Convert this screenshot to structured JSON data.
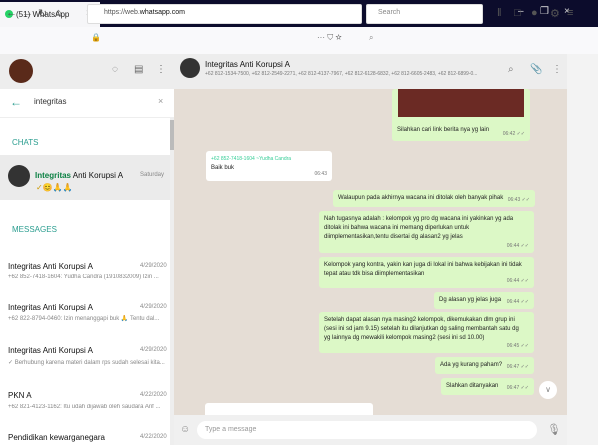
{
  "browser": {
    "tab_title": "(51) WhatsApp",
    "tab_close": "×",
    "new_tab": "+",
    "win_min": "–",
    "win_max": "❐",
    "win_close": "×",
    "url_prefix": "https://web.",
    "url_domain": "whatsapp.com",
    "url_menu": "··· ⛉ ☆",
    "search_placeholder": "Search"
  },
  "sidebar": {
    "search_value": "integritas",
    "chats_label": "CHATS",
    "messages_label": "MESSAGES",
    "chat": {
      "name_highlight": "Integritas",
      "name_rest": " Anti Korupsi A",
      "time": "Saturday",
      "preview": "✓😊🙏🙏"
    },
    "messages": [
      {
        "name": "Integritas Anti Korupsi A",
        "date": "4/29/2020",
        "preview": "+62 852-7418-1604: Yudha Candra (1910832009) Izin ..."
      },
      {
        "name": "Integritas Anti Korupsi A",
        "date": "4/29/2020",
        "preview": "+62 822-8794-0460: Izin menanggapi buk 🙏 Tentu dal..."
      },
      {
        "name": "Integritas Anti Korupsi A",
        "date": "4/29/2020",
        "preview": "✓ Berhubung karena materi dalam rps sudah selesai kita..."
      },
      {
        "name": "PKN A",
        "date": "4/22/2020",
        "preview": "+62 821-4123-1162: Itu udah dijawab oleh saudara Arif ..."
      },
      {
        "name": "Pendidikan kewarganegara",
        "date": "4/22/2020",
        "preview": ""
      }
    ]
  },
  "conversation": {
    "title": "Integritas Anti Korupsi A",
    "participants": "+62 812-1534-7500, +62 812-2549-2271, +62 812-4137-7967, +62 812-6128-6832, +62 812-6605-2483, +62 812-6899-0...",
    "messages": [
      {
        "dir": "out",
        "text": "Silahkan cari link berita nya yg lain",
        "time": "06:42 ✓✓"
      },
      {
        "dir": "in",
        "sender": "+62 852-7418-1604 ~Yudha Candra",
        "text": "Baik buk",
        "time": "06:43"
      },
      {
        "dir": "out",
        "text": "Walaupun pada akhirnya wacana ini ditolak oleh banyak pihak",
        "time": "06:43 ✓✓"
      },
      {
        "dir": "out",
        "text": "Nah tugasnya adalah : kelompok yg pro dg wacana ini yakinkan yg ada ditolak ini bahwa wacana ini memang diperlukan untuk diimplementasikan,tentu disertai dg alasan2 yg jelas",
        "time": "06:44 ✓✓"
      },
      {
        "dir": "out",
        "text": "Kelompok yang kontra, yakin kan juga di lokal ini bahwa kebijakan ini tidak tepat atau tdk bisa diimplementasikan",
        "time": "06:44 ✓✓"
      },
      {
        "dir": "out",
        "text": "Dg alasan yg jelas juga",
        "time": "06:44 ✓✓"
      },
      {
        "dir": "out",
        "text": "Setelah dapat alasan nya masing2 kelompok, dikemukakan dlm grup ini (sesi ini sd jam 9.15) setelah itu dilanjutkan dg saling membantah satu dg yg lainnya dg mewakili kelompok masing2 (sesi ini sd 10.00)",
        "time": "06:45 ✓✓"
      },
      {
        "dir": "out",
        "text": "Ada yg kurang paham?",
        "time": "06:47 ✓✓"
      },
      {
        "dir": "out",
        "text": "Slahkan ditanyakan",
        "time": "06:47 ✓✓"
      }
    ],
    "composer_placeholder": "Type a message"
  },
  "icons": [
    "back-icon",
    "forward-icon",
    "reload-icon",
    "home-icon",
    "shield-icon",
    "lock-icon",
    "search-icon",
    "library-icon",
    "reader-icon",
    "profile-icon",
    "menu-icon",
    "status-icon",
    "chat-icon",
    "attach-icon",
    "emoji-icon",
    "mic-icon",
    "scroll-down-icon"
  ],
  "colors": {
    "accent": "#2a9d8f",
    "outgoing": "#dcf8c6",
    "chat_bg": "#e5ddd5",
    "tabbar": "#0c0c2c"
  }
}
